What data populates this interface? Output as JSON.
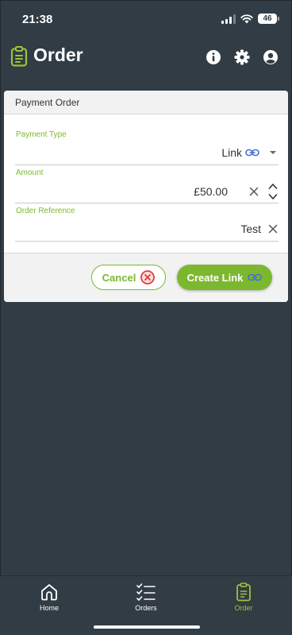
{
  "status_bar": {
    "time": "21:38",
    "battery": "46"
  },
  "header": {
    "title": "Order"
  },
  "card": {
    "title": "Payment Order",
    "payment_type": {
      "label": "Payment Type",
      "value": "Link"
    },
    "amount": {
      "label": "Amount",
      "value": "£50.00"
    },
    "order_reference": {
      "label": "Order Reference",
      "value": "Test"
    },
    "cancel_label": "Cancel",
    "create_label": "Create Link"
  },
  "nav": {
    "items": [
      {
        "label": "Home",
        "icon": "home-icon"
      },
      {
        "label": "Orders",
        "icon": "checklist-icon"
      },
      {
        "label": "Order",
        "icon": "clipboard-icon",
        "active": true
      }
    ]
  },
  "colors": {
    "background": "#313c45",
    "accent": "#7cb82f",
    "nav_active": "#9cc33a",
    "link_icon": "#4a6fd1",
    "cancel_icon": "#e23c3c"
  }
}
